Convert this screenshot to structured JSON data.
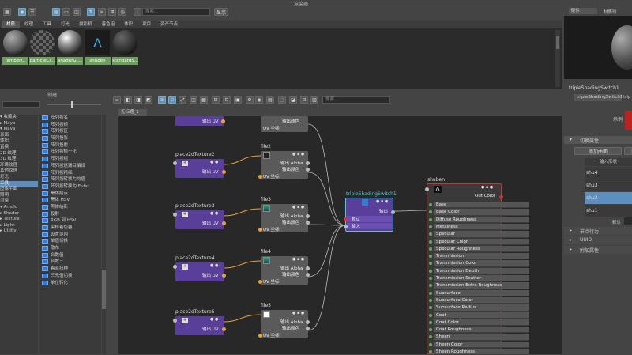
{
  "window": {
    "title": "渲染器"
  },
  "top": {
    "search_placeholder": "搜索...",
    "show_label": "显示"
  },
  "hypershade_tabs": [
    "材质",
    "纹理",
    "工具",
    "灯光",
    "摄影机",
    "着色组",
    "体积",
    "项目",
    "资产节点"
  ],
  "materials": [
    {
      "name": "lambert1",
      "kind": "lambert"
    },
    {
      "name": "particleCl...",
      "kind": "checker"
    },
    {
      "name": "shaderGl...",
      "kind": "glow"
    },
    {
      "name": "shuben",
      "kind": "arnold"
    },
    {
      "name": "standardS...",
      "kind": "dark"
    }
  ],
  "create": {
    "title": "创建",
    "tree": [
      "▾ 收藏夹",
      "  ▸ Maya",
      "▾ Maya",
      "    表面",
      "    体积",
      "    置换",
      "    2D 纹理",
      "    3D 纹理",
      "    环境纹理",
      "    其他纹理",
      "    灯光",
      "    工具",
      "    图像平面",
      "    照明",
      "    渲染",
      "▾ Arnold",
      "  ▸ Shader",
      "  ▸ Texture",
      "  ▸ Light",
      "  ▸ Utility"
    ],
    "tree_selected": 11,
    "nodes": [
      "阵列按名",
      "阵列按帧",
      "阵列按区",
      "阵列投影",
      "阵列投射",
      "阵列按帧一化",
      "阵列按组",
      "阵列按逐漏目编译",
      "阵列按精细",
      "阵列按转换为均值",
      "阵列按转换为 Euler",
      "黑体结点",
      "黑体 HSV",
      "黑体纳新",
      "投射",
      "RGB 到 HSV",
      "采样着色器",
      "设置范围",
      "单值切换",
      "散布",
      "合数值",
      "合数三",
      "着蓝扭种",
      "三元值切换",
      "单位转化"
    ]
  },
  "graph": {
    "tab": "无标题_1",
    "search_placeholder": "搜索..."
  },
  "nodes": {
    "place_top": {
      "out": "输出 UV"
    },
    "file_top": {
      "uv": "UV 坐标",
      "color": "输出颜色"
    },
    "place2": {
      "title": "place2dTexture2",
      "out": "输出 UV"
    },
    "file2": {
      "title": "file2",
      "alpha": "输出 Alpha",
      "color": "输出颜色",
      "uv": "UV 坐标"
    },
    "place3": {
      "title": "place2dTexture3",
      "out": "输出 UV"
    },
    "file3": {
      "title": "file3",
      "alpha": "输出 Alpha",
      "color": "输出颜色",
      "uv": "UV 坐标"
    },
    "place4": {
      "title": "place2dTexture4",
      "out": "输出 UV"
    },
    "file4": {
      "title": "file4",
      "alpha": "输出 Alpha",
      "color": "输出颜色",
      "uv": "UV 坐标"
    },
    "place5": {
      "title": "place2dTexture5",
      "out": "输出 UV"
    },
    "file5": {
      "title": "file5",
      "alpha": "输出 Alpha",
      "color": "输出颜色",
      "uv": "UV 坐标"
    },
    "switch": {
      "title": "tripleShadingSwitch1",
      "out": "输出",
      "default": "默认",
      "input": "输入"
    },
    "shuben": {
      "title": "shuben",
      "out": "Out Color"
    }
  },
  "shuben_attrs": [
    "Base",
    "Base Color",
    "Diffuse Roughness",
    "Metalness",
    "Specular",
    "Specular Color",
    "Specular Roughness",
    "Transmission",
    "Transmission Color",
    "Transmission Depth",
    "Transmission Scatter",
    "Transmission Extra Roughness",
    "Subsurface",
    "Subsurface Color",
    "Subsurface Radius",
    "Coat",
    "Coat Color",
    "Coat Roughness",
    "Sheen",
    "Sheen Color",
    "Sheen Roughness"
  ],
  "right": {
    "render_mode": "硬件",
    "material_label": "材质球",
    "node_name": "tripleShadingSwitch1",
    "tab": "tripleShadingSwitch1",
    "tab2": "trip",
    "sample_label": "示例",
    "section_switch": "切换属性",
    "add_button": "添加曲面",
    "input_header": "输入形状",
    "shapes": [
      "shu4",
      "shu3",
      "shu2",
      "shu1"
    ],
    "shape_selected": 2,
    "default_label": "默认",
    "sections": [
      "节点行为",
      "UUID",
      "附加属性"
    ]
  }
}
